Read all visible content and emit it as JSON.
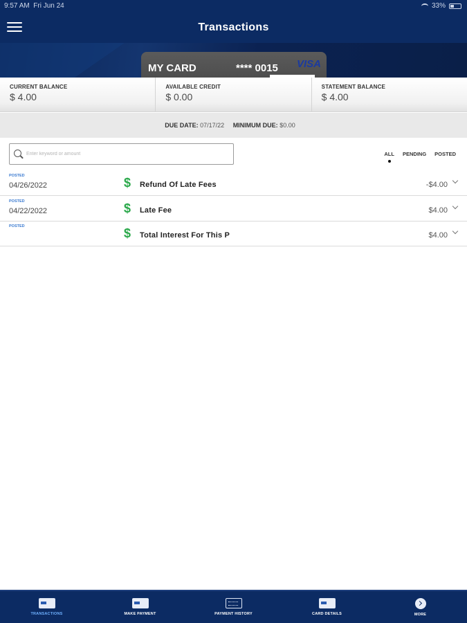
{
  "status_bar": {
    "time": "9:57 AM",
    "date": "Fri Jun 24",
    "battery": "33%"
  },
  "header": {
    "title": "Transactions"
  },
  "card": {
    "name": "MY CARD",
    "number": "**** 0015",
    "brand": "VISA"
  },
  "balances": [
    {
      "label": "CURRENT BALANCE",
      "value": "$ 4.00"
    },
    {
      "label": "AVAILABLE CREDIT",
      "value": "$ 0.00"
    },
    {
      "label": "STATEMENT BALANCE",
      "value": "$ 4.00"
    }
  ],
  "due": {
    "due_label": "DUE DATE:",
    "due_value": "07/17/22",
    "min_label": "MINIMUM DUE:",
    "min_value": "$0.00"
  },
  "search": {
    "placeholder": "Enter keyword or amount"
  },
  "filters": {
    "all": "ALL",
    "pending": "PENDING",
    "posted": "POSTED"
  },
  "transactions": [
    {
      "status": "POSTED",
      "date": "04/26/2022",
      "icon": "$",
      "description": "Refund Of Late Fees",
      "amount": "-$4.00"
    },
    {
      "status": "POSTED",
      "date": "04/22/2022",
      "icon": "$",
      "description": "Late Fee",
      "amount": "$4.00"
    },
    {
      "status": "POSTED",
      "date": "",
      "icon": "$",
      "description": "Total Interest For This P",
      "amount": "$4.00"
    }
  ],
  "nav": [
    {
      "label": "TRANSACTIONS",
      "icon": "card-swipe-icon"
    },
    {
      "label": "MAKE PAYMENT",
      "icon": "payment-card-icon"
    },
    {
      "label": "PAYMENT HISTORY",
      "icon": "history-icon"
    },
    {
      "label": "CARD DETAILS",
      "icon": "card-details-icon"
    },
    {
      "label": "MORE",
      "icon": "more-icon"
    }
  ],
  "colors": {
    "header_bg": "#0c2b63",
    "accent_green": "#2aa84a",
    "status_blue": "#3a7ad0",
    "active_nav": "#6fb1ff"
  }
}
